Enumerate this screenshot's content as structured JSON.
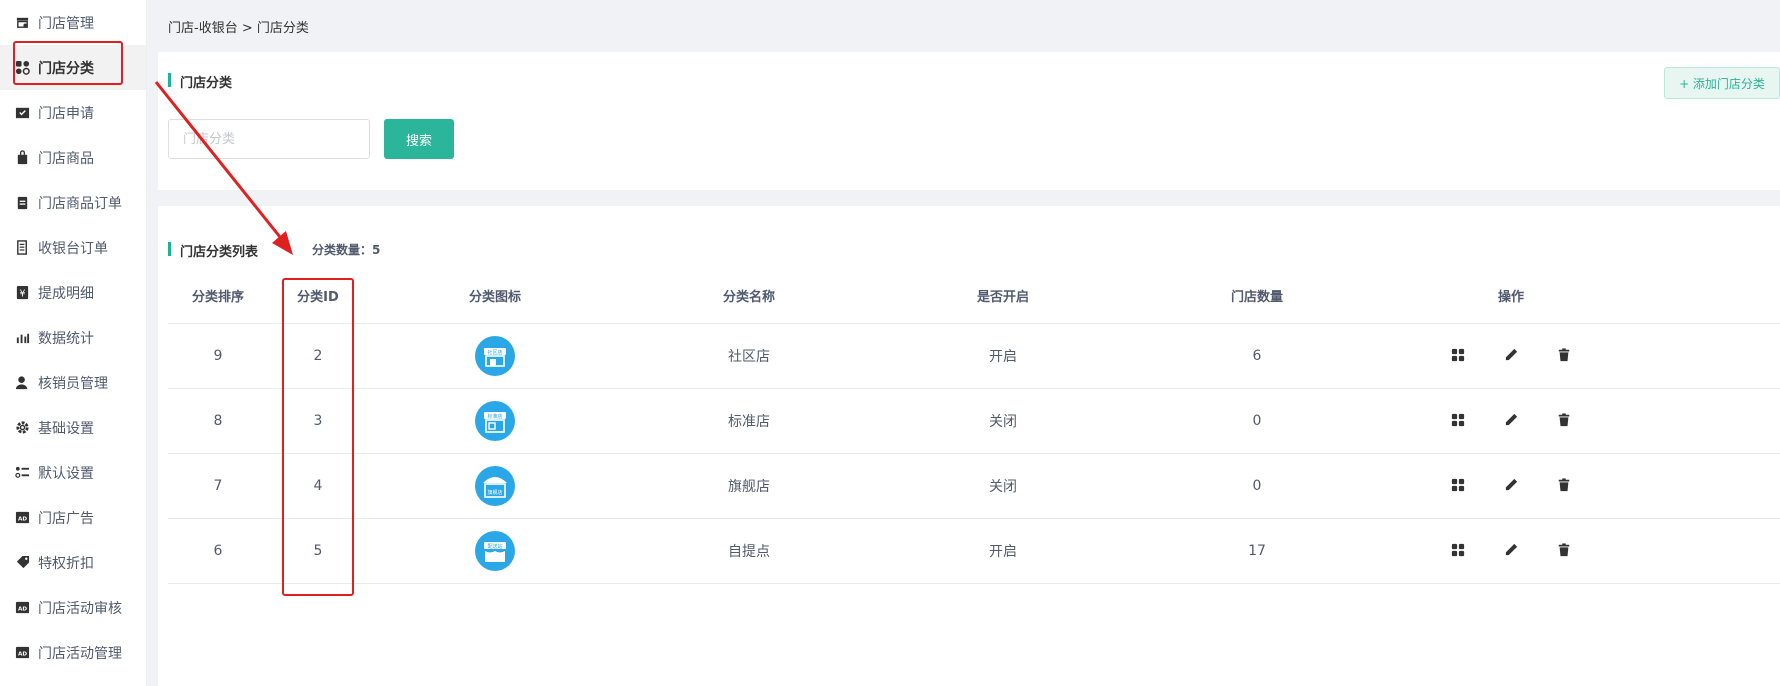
{
  "sidebar": {
    "items": [
      {
        "label": "门店管理",
        "icon": "store-icon"
      },
      {
        "label": "门店分类",
        "icon": "category-grid-icon",
        "active": true
      },
      {
        "label": "门店申请",
        "icon": "apply-folder-icon"
      },
      {
        "label": "门店商品",
        "icon": "shopping-bag-icon"
      },
      {
        "label": "门店商品订单",
        "icon": "clipboard-icon"
      },
      {
        "label": "收银台订单",
        "icon": "receipt-icon"
      },
      {
        "label": "提成明细",
        "icon": "yen-icon"
      },
      {
        "label": "数据统计",
        "icon": "bar-chart-icon"
      },
      {
        "label": "核销员管理",
        "icon": "user-icon"
      },
      {
        "label": "基础设置",
        "icon": "gear-icon"
      },
      {
        "label": "默认设置",
        "icon": "list-settings-icon"
      },
      {
        "label": "门店广告",
        "icon": "ad-icon"
      },
      {
        "label": "特权折扣",
        "icon": "tag-icon"
      },
      {
        "label": "门店活动审核",
        "icon": "ad-icon"
      },
      {
        "label": "门店活动管理",
        "icon": "ad-icon"
      }
    ]
  },
  "breadcrumb": "门店-收银台 > 门店分类",
  "search": {
    "title": "门店分类",
    "placeholder": "门店分类",
    "button": "搜索",
    "add_button": "+ 添加门店分类"
  },
  "list": {
    "title": "门店分类列表",
    "count_label": "分类数量：5",
    "columns": [
      "分类排序",
      "分类ID",
      "分类图标",
      "分类名称",
      "是否开启",
      "门店数量",
      "操作"
    ],
    "rows": [
      {
        "sort": "9",
        "id": "2",
        "icon_text": "社区店",
        "name": "社区店",
        "enabled": "开启",
        "stores": "6"
      },
      {
        "sort": "8",
        "id": "3",
        "icon_text": "标准店",
        "name": "标准店",
        "enabled": "关闭",
        "stores": "0"
      },
      {
        "sort": "7",
        "id": "4",
        "icon_text": "旗舰店",
        "name": "旗舰店",
        "enabled": "关闭",
        "stores": "0"
      },
      {
        "sort": "6",
        "id": "5",
        "icon_text": "配送站",
        "name": "自提点",
        "enabled": "开启",
        "stores": "17"
      }
    ]
  },
  "colors": {
    "accent": "#2bb59a",
    "annotation": "#e02020",
    "icon_blue": "#2aa7e6"
  }
}
